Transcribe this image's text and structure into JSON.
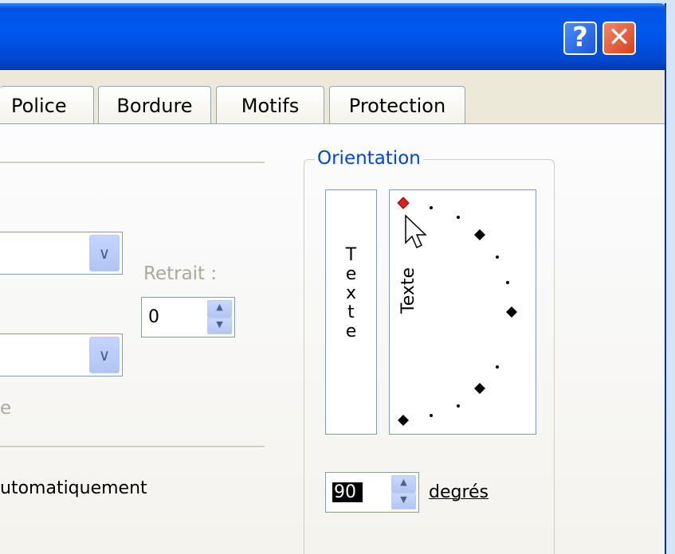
{
  "dialog": {
    "help_glyph": "?",
    "close_glyph": "✕"
  },
  "tabs": [
    {
      "label": "Police"
    },
    {
      "label": "Bordure"
    },
    {
      "label": "Motifs"
    },
    {
      "label": "Protection"
    }
  ],
  "alignment": {
    "horizontal_value": "",
    "vertical_value": "",
    "indent_label": "Retrait :",
    "indent_value": "0",
    "partial_label_fragment": "e",
    "auto_fit_fragment": "utomatiquement"
  },
  "orientation": {
    "group_title": "Orientation",
    "vertical_text": [
      "T",
      "e",
      "x",
      "t",
      "e"
    ],
    "rotated_text": "Texte",
    "degrees_value": "90",
    "degrees_label": "degrés",
    "degrees_label_underline_char": "d"
  },
  "colors": {
    "titlebar_blue": "#0054e3",
    "group_title_blue": "#0046d5",
    "disabled_gray": "#aca899",
    "close_red": "#d8401c",
    "dial_marker_red": "#e02020"
  },
  "icons": {
    "dropdown": "chevron-down-icon",
    "spin_up": "triangle-up-icon",
    "spin_down": "triangle-down-icon",
    "cursor": "mouse-cursor-icon"
  }
}
